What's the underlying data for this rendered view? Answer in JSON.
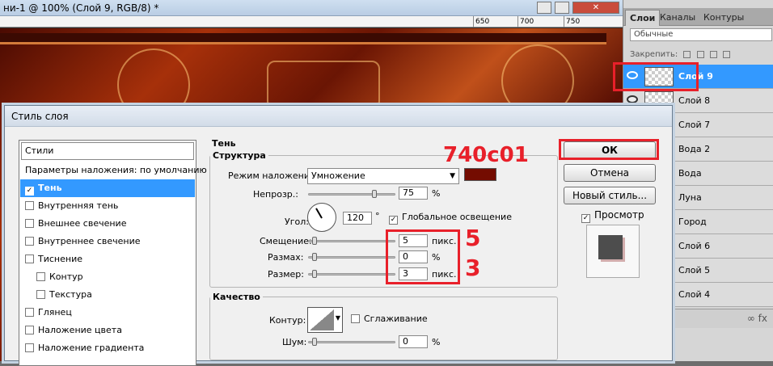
{
  "document": {
    "title": "ни-1 @ 100% (Слой 9, RGB/8) *",
    "ruler_ticks": [
      "650",
      "700",
      "750"
    ]
  },
  "layers_panel": {
    "tabs": [
      "Слои",
      "Каналы",
      "Контуры"
    ],
    "blend_mode": "Обычные",
    "lock_label": "Закрепить:",
    "layers": [
      "Слой 9",
      "Слой 8",
      "Слой 7",
      "Вода 2",
      "Вода",
      "Луна",
      "Город",
      "Слой 6",
      "Слой 5",
      "Слой 4"
    ],
    "bottom_icons": "∞  fx"
  },
  "dialog": {
    "title": "Стиль слоя",
    "styles_header": "Стили",
    "styles": [
      {
        "label": "Параметры наложения: по умолчанию",
        "checkbox": false,
        "checked": false
      },
      {
        "label": "Тень",
        "checkbox": true,
        "checked": true,
        "selected": true
      },
      {
        "label": "Внутренняя тень",
        "checkbox": true,
        "checked": false
      },
      {
        "label": "Внешнее свечение",
        "checkbox": true,
        "checked": false
      },
      {
        "label": "Внутреннее свечение",
        "checkbox": true,
        "checked": false
      },
      {
        "label": "Тиснение",
        "checkbox": true,
        "checked": false
      },
      {
        "label": "Контур",
        "checkbox": true,
        "checked": false,
        "indent": true
      },
      {
        "label": "Текстура",
        "checkbox": true,
        "checked": false,
        "indent": true
      },
      {
        "label": "Глянец",
        "checkbox": true,
        "checked": false
      },
      {
        "label": "Наложение цвета",
        "checkbox": true,
        "checked": false
      },
      {
        "label": "Наложение градиента",
        "checkbox": true,
        "checked": false
      }
    ],
    "section_title": "Тень",
    "structure": {
      "legend": "Структура",
      "blend_label": "Режим наложения:",
      "blend_value": "Умножение",
      "shadow_color": "#740c01",
      "opacity_label": "Непрозр.:",
      "opacity_value": "75",
      "opacity_unit": "%",
      "opacity_level": 0.75,
      "angle_label": "Угол:",
      "angle_value": "120",
      "angle_unit": "°",
      "global_light_label": "Глобальное освещение",
      "distance_label": "Смещение:",
      "distance_value": "5",
      "distance_unit": "пикс.",
      "spread_label": "Размах:",
      "spread_value": "0",
      "spread_unit": "%",
      "size_label": "Размер:",
      "size_value": "3",
      "size_unit": "пикс."
    },
    "quality": {
      "legend": "Качество",
      "contour_label": "Контур:",
      "antialias_label": "Сглаживание",
      "noise_label": "Шум:",
      "noise_value": "0",
      "noise_unit": "%"
    },
    "buttons": {
      "ok": "ОК",
      "cancel": "Отмена",
      "new_style": "Новый стиль...",
      "preview": "Просмотр"
    }
  },
  "annotations": {
    "color_code": "740c01",
    "mark_5": "5",
    "mark_3": "3",
    "mark_color": "#e8202a"
  }
}
